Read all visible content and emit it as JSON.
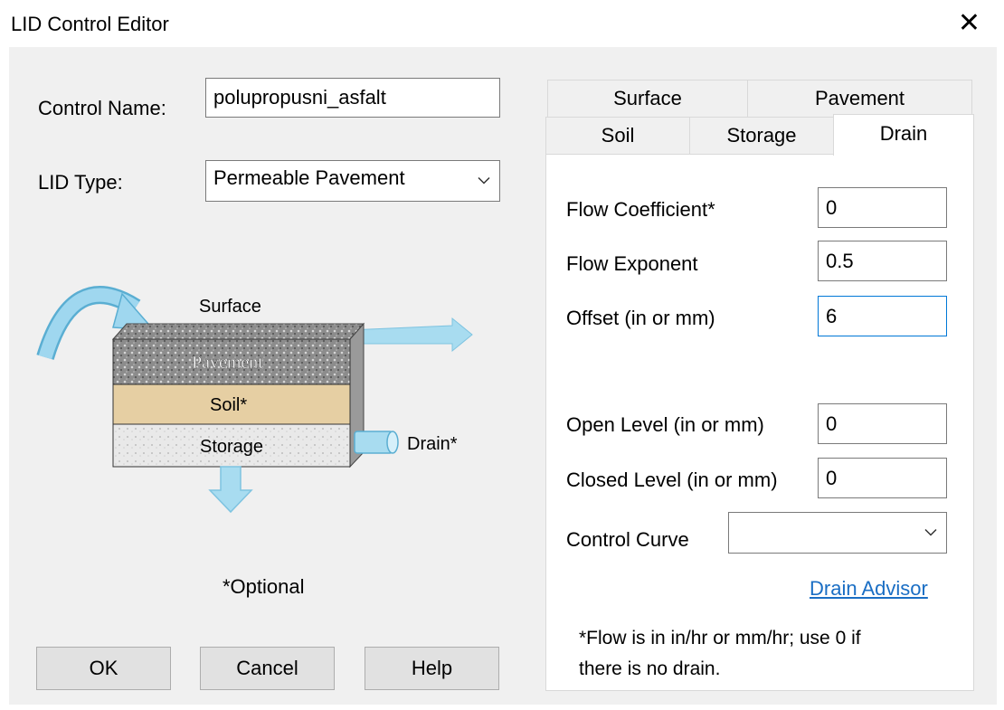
{
  "window": {
    "title": "LID Control Editor",
    "close_glyph": "✕"
  },
  "form": {
    "control_name_label": "Control Name:",
    "control_name_value": "polupropusni_asfalt",
    "lid_type_label": "LID Type:",
    "lid_type_value": "Permeable Pavement"
  },
  "diagram": {
    "surface": "Surface",
    "pavement": "Pavement",
    "soil": "Soil*",
    "storage": "Storage",
    "drain": "Drain*",
    "optional_note": "*Optional"
  },
  "buttons": {
    "ok": "OK",
    "cancel": "Cancel",
    "help": "Help"
  },
  "tabs": {
    "row1": [
      "Surface",
      "Pavement"
    ],
    "row2": [
      "Soil",
      "Storage",
      "Drain"
    ],
    "selected": "Drain"
  },
  "drain": {
    "flow_coefficient_label": "Flow Coefficient*",
    "flow_coefficient_value": "0",
    "flow_exponent_label": "Flow Exponent",
    "flow_exponent_value": "0.5",
    "offset_label": "Offset (in or mm)",
    "offset_value": "6",
    "open_level_label": "Open Level (in or mm)",
    "open_level_value": "0",
    "closed_level_label": "Closed Level (in or mm)",
    "closed_level_value": "0",
    "control_curve_label": "Control Curve",
    "control_curve_value": "",
    "advisor_link": "Drain Advisor",
    "note_line1": "*Flow is in in/hr or mm/hr; use 0 if",
    "note_line2": "there is no drain."
  },
  "colors": {
    "link": "#1a6ec4",
    "arrow": "#8fd0ea",
    "soil": "#e6cfa3",
    "focus": "#0078d7"
  }
}
